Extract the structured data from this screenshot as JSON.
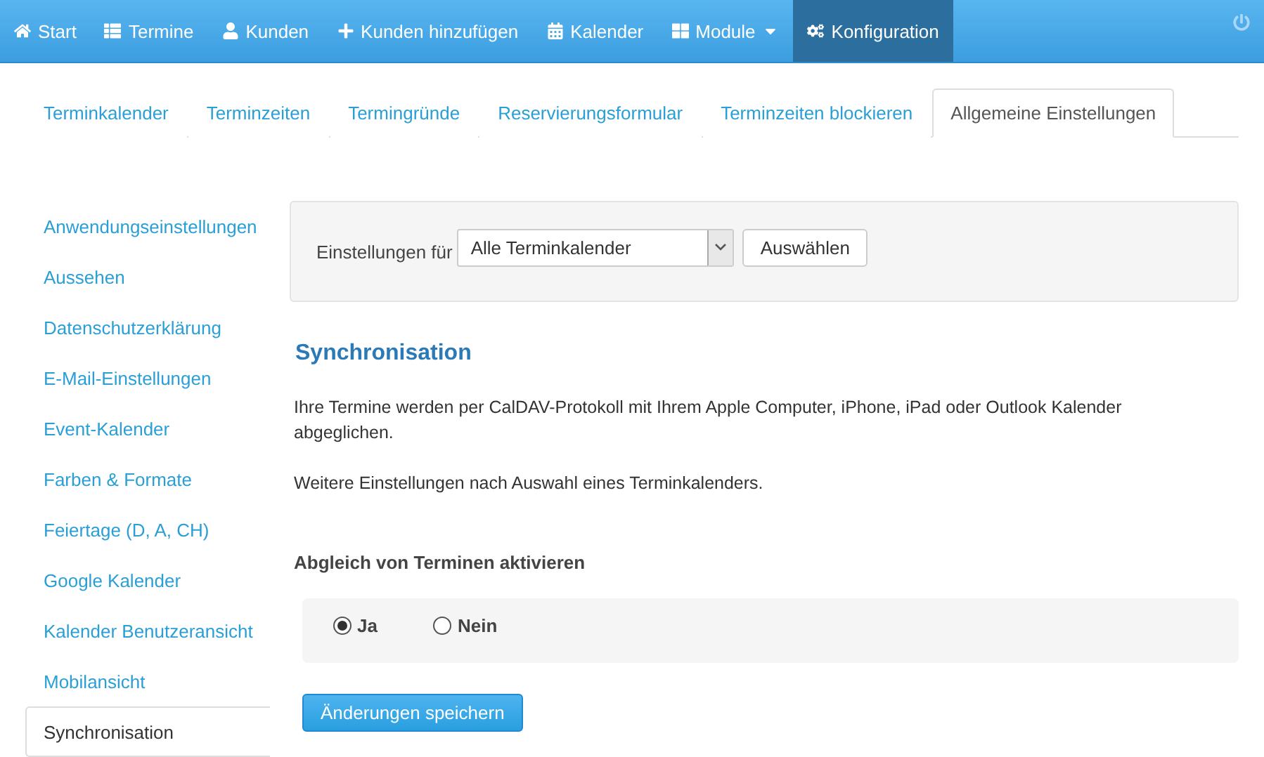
{
  "navbar": {
    "items": [
      {
        "label": "Start",
        "selected": false,
        "dropdown": false
      },
      {
        "label": "Termine",
        "selected": false,
        "dropdown": false
      },
      {
        "label": "Kunden",
        "selected": false,
        "dropdown": false
      },
      {
        "label": "Kunden hinzufügen",
        "selected": false,
        "dropdown": false
      },
      {
        "label": "Kalender",
        "selected": false,
        "dropdown": false
      },
      {
        "label": "Module",
        "selected": false,
        "dropdown": true
      },
      {
        "label": "Konfiguration",
        "selected": true,
        "dropdown": false
      }
    ]
  },
  "tabs": [
    {
      "label": "Terminkalender",
      "selected": false
    },
    {
      "label": "Terminzeiten",
      "selected": false
    },
    {
      "label": "Termingründe",
      "selected": false
    },
    {
      "label": "Reservierungsformular",
      "selected": false
    },
    {
      "label": "Terminzeiten blockieren",
      "selected": false
    },
    {
      "label": "Allgemeine Einstellungen",
      "selected": true
    }
  ],
  "sidebar": {
    "items": [
      {
        "label": "Anwendungseinstellungen",
        "selected": false
      },
      {
        "label": "Aussehen",
        "selected": false
      },
      {
        "label": "Datenschutzerklärung",
        "selected": false
      },
      {
        "label": "E-Mail-Einstellungen",
        "selected": false
      },
      {
        "label": "Event-Kalender",
        "selected": false
      },
      {
        "label": "Farben & Formate",
        "selected": false
      },
      {
        "label": "Feiertage (D, A, CH)",
        "selected": false
      },
      {
        "label": "Google Kalender",
        "selected": false
      },
      {
        "label": "Kalender Benutzeransicht",
        "selected": false
      },
      {
        "label": "Mobilansicht",
        "selected": false
      },
      {
        "label": "Synchronisation",
        "selected": true
      }
    ]
  },
  "filter": {
    "label": "Einstellungen für",
    "select_value": "Alle Terminkalender",
    "button": "Auswählen"
  },
  "section": {
    "title": "Synchronisation",
    "paragraphs": [
      "Ihre Termine werden per CalDAV-Protokoll mit Ihrem Apple Computer, iPhone, iPad oder Outlook Kalender abgeglichen.",
      "Weitere Einstellungen nach Auswahl eines Terminkalenders."
    ]
  },
  "sync_option": {
    "label": "Abgleich von Terminen aktivieren",
    "options": [
      {
        "label": "Ja",
        "selected": true
      },
      {
        "label": "Nein",
        "selected": false
      }
    ]
  },
  "save_button": "Änderungen speichern"
}
